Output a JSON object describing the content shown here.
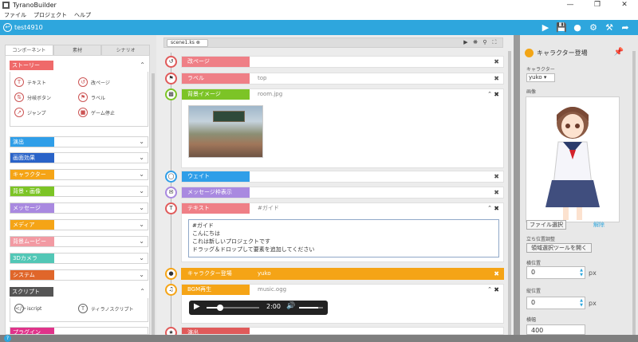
{
  "app": {
    "title": "TyranoBuilder",
    "minimize": "—",
    "maximize": "❐",
    "close": "✕"
  },
  "menu": [
    "ファイル",
    "プロジェクト",
    "ヘルプ"
  ],
  "project": {
    "name": "test4910"
  },
  "toolbar_icons": [
    "play-icon",
    "save-icon",
    "character-icon",
    "gear-icon",
    "build-icon",
    "export-icon"
  ],
  "left": {
    "tabs": [
      "コンポーネント",
      "素材",
      "シナリオ"
    ],
    "story": {
      "label": "ストーリー",
      "items": [
        "テキスト",
        "改ページ",
        "分岐ボタン",
        "ラベル",
        "ジャンプ",
        "ゲーム停止"
      ]
    },
    "categories": [
      {
        "label": "演出",
        "color": "#2f9ee8"
      },
      {
        "label": "画面効果",
        "color": "#2a63c8"
      },
      {
        "label": "キャラクター",
        "color": "#f5a416"
      },
      {
        "label": "背景・画像",
        "color": "#7cc426"
      },
      {
        "label": "メッセージ",
        "color": "#a989e0"
      },
      {
        "label": "メディア",
        "color": "#f5a416"
      },
      {
        "label": "背景ムービー",
        "color": "#f29aa3"
      },
      {
        "label": "3Dカメラ",
        "color": "#52c7b6"
      },
      {
        "label": "システム",
        "color": "#e0662a"
      }
    ],
    "script": {
      "label": "スクリプト",
      "items": [
        "iscript",
        "ティラノスクリプト"
      ]
    },
    "plugin": {
      "label": "プラグイン"
    }
  },
  "scene": {
    "tab": "scene1.ks",
    "close": "⊗"
  },
  "rows": {
    "r0": {
      "label": "改ページ",
      "value": ""
    },
    "r1": {
      "label": "ラベル",
      "value": "top"
    },
    "r2": {
      "label": "背景イメージ",
      "value": "room.jpg"
    },
    "r3": {
      "label": "ウェイト",
      "value": ""
    },
    "r4": {
      "label": "メッセージ枠表示",
      "value": ""
    },
    "r5": {
      "label": "テキスト",
      "value": "#ガイド"
    },
    "r6": {
      "label": "キャラクター登場",
      "value": "yuko"
    },
    "r7": {
      "label": "BGM再生",
      "value": "music.ogg"
    },
    "r8": {
      "label": "演出",
      "value": ""
    }
  },
  "text_lines": [
    "#ガイド",
    "こんにちは",
    "これは新しいプロジェクトです",
    "ドラッグ＆ドロップして要素を追加してください"
  ],
  "player": {
    "time": "2:00",
    "progress": 0.25,
    "volume": 0.8
  },
  "right": {
    "title": "キャラクター登場",
    "char_label": "キャラクター",
    "char_value": "yuko",
    "image_label": "画像",
    "file_button": "ファイル選択",
    "remove": "解除",
    "pos_label": "立ち位置調整",
    "region_button": "領域選択ツールを開く",
    "x_label": "横位置",
    "x_value": "0",
    "y_label": "縦位置",
    "y_value": "0",
    "w_label": "横幅",
    "w_value": "400",
    "unit": "px"
  }
}
